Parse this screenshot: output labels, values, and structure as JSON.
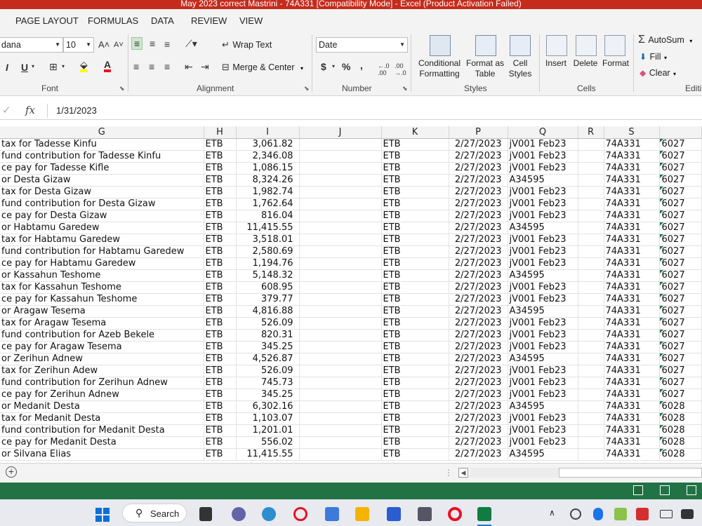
{
  "window_title": "May 2023 correct Mastrini - 74A331  [Compatibility Mode] -  Excel (Product Activation Failed)",
  "menu": [
    "PAGE LAYOUT",
    "FORMULAS",
    "DATA",
    "REVIEW",
    "VIEW"
  ],
  "ribbon": {
    "font_name": "dana",
    "font_size": "10",
    "wrap_text": "Wrap Text",
    "merge_center": "Merge & Center",
    "number_format": "Date",
    "currency_symbol": "$",
    "percent_symbol": "%",
    "comma_symbol": ",",
    "conditional_formatting": "Conditional Formatting",
    "format_as_table": "Format as Table",
    "cell_styles": "Cell Styles",
    "insert": "Insert",
    "delete": "Delete",
    "format": "Format",
    "autosum": "AutoSum",
    "fill": "Fill",
    "clear": "Clear",
    "groups": {
      "font": "Font",
      "alignment": "Alignment",
      "number": "Number",
      "styles": "Styles",
      "cells": "Cells",
      "editing": "Editi"
    }
  },
  "formula_bar": {
    "fx": "fx",
    "value": "1/31/2023"
  },
  "columns": [
    "G",
    "H",
    "I",
    "J",
    "K",
    "P",
    "Q",
    "R",
    "S",
    ""
  ],
  "rows": [
    [
      "tax for Tadesse Kinfu",
      "ETB",
      "3,061.82",
      "",
      "ETB",
      "2/27/2023",
      "jV001 Feb23",
      "",
      "74A331",
      "6027"
    ],
    [
      " fund contribution for Tadesse Kinfu",
      "ETB",
      "2,346.08",
      "",
      "ETB",
      "2/27/2023",
      "jV001 Feb23",
      "",
      "74A331",
      "6027"
    ],
    [
      "ce pay for Tadesse Kifle",
      "ETB",
      "1,086.15",
      "",
      "ETB",
      "2/27/2023",
      "jV001 Feb23",
      "",
      "74A331",
      "6027"
    ],
    [
      "or Desta Gizaw",
      "ETB",
      "8,324.26",
      "",
      "ETB",
      "2/27/2023",
      "A34595",
      "",
      "74A331",
      "6027"
    ],
    [
      "tax for Desta Gizaw",
      "ETB",
      "1,982.74",
      "",
      "ETB",
      "2/27/2023",
      "jV001 Feb23",
      "",
      "74A331",
      "6027"
    ],
    [
      " fund contribution for Desta Gizaw",
      "ETB",
      "1,762.64",
      "",
      "ETB",
      "2/27/2023",
      "jV001 Feb23",
      "",
      "74A331",
      "6027"
    ],
    [
      "ce pay for Desta Gizaw",
      "ETB",
      "816.04",
      "",
      "ETB",
      "2/27/2023",
      "jV001 Feb23",
      "",
      "74A331",
      "6027"
    ],
    [
      "or Habtamu Garedew",
      "ETB",
      "11,415.55",
      "",
      "ETB",
      "2/27/2023",
      "A34595",
      "",
      "74A331",
      "6027"
    ],
    [
      "tax for Habtamu Garedew",
      "ETB",
      "3,518.01",
      "",
      "ETB",
      "2/27/2023",
      "jV001 Feb23",
      "",
      "74A331",
      "6027"
    ],
    [
      " fund contribution for Habtamu Garedew",
      "ETB",
      "2,580.69",
      "",
      "ETB",
      "2/27/2023",
      "jV001 Feb23",
      "",
      "74A331",
      "6027"
    ],
    [
      "ce pay for Habtamu Garedew",
      "ETB",
      "1,194.76",
      "",
      "ETB",
      "2/27/2023",
      "jV001 Feb23",
      "",
      "74A331",
      "6027"
    ],
    [
      "or Kassahun Teshome",
      "ETB",
      "5,148.32",
      "",
      "ETB",
      "2/27/2023",
      "A34595",
      "",
      "74A331",
      "6027"
    ],
    [
      "tax for Kassahun Teshome",
      "ETB",
      "608.95",
      "",
      "ETB",
      "2/27/2023",
      "jV001 Feb23",
      "",
      "74A331",
      "6027"
    ],
    [
      "ce pay for Kassahun Teshome",
      "ETB",
      "379.77",
      "",
      "ETB",
      "2/27/2023",
      "jV001 Feb23",
      "",
      "74A331",
      "6027"
    ],
    [
      "or Aragaw Tesema",
      "ETB",
      "4,816.88",
      "",
      "ETB",
      "2/27/2023",
      "A34595",
      "",
      "74A331",
      "6027"
    ],
    [
      "tax for Aragaw Tesema",
      "ETB",
      "526.09",
      "",
      "ETB",
      "2/27/2023",
      "jV001 Feb23",
      "",
      "74A331",
      "6027"
    ],
    [
      " fund contribution for Azeb Bekele",
      "ETB",
      "820.31",
      "",
      "ETB",
      "2/27/2023",
      "jV001 Feb23",
      "",
      "74A331",
      "6027"
    ],
    [
      "ce pay for Aragaw Tesema",
      "ETB",
      "345.25",
      "",
      "ETB",
      "2/27/2023",
      "jV001 Feb23",
      "",
      "74A331",
      "6027"
    ],
    [
      "or Zerihun Adnew",
      "ETB",
      "4,526.87",
      "",
      "ETB",
      "2/27/2023",
      "A34595",
      "",
      "74A331",
      "6027"
    ],
    [
      "tax for Zerihun Adew",
      "ETB",
      "526.09",
      "",
      "ETB",
      "2/27/2023",
      "jV001 Feb23",
      "",
      "74A331",
      "6027"
    ],
    [
      " fund contribution for Zerihun Adnew",
      "ETB",
      "745.73",
      "",
      "ETB",
      "2/27/2023",
      "jV001 Feb23",
      "",
      "74A331",
      "6027"
    ],
    [
      "ce pay for Zerihun Adnew",
      "ETB",
      "345.25",
      "",
      "ETB",
      "2/27/2023",
      "jV001 Feb23",
      "",
      "74A331",
      "6027"
    ],
    [
      "or Medanit Desta",
      "ETB",
      "6,302.16",
      "",
      "ETB",
      "2/27/2023",
      "A34595",
      "",
      "74A331",
      "6028"
    ],
    [
      "tax for Medanit Desta",
      "ETB",
      "1,103.07",
      "",
      "ETB",
      "2/27/2023",
      "jV001 Feb23",
      "",
      "74A331",
      "6028"
    ],
    [
      " fund contribution for Medanit Desta",
      "ETB",
      "1,201.01",
      "",
      "ETB",
      "2/27/2023",
      "jV001 Feb23",
      "",
      "74A331",
      "6028"
    ],
    [
      "ce pay for Medanit Desta",
      "ETB",
      "556.02",
      "",
      "ETB",
      "2/27/2023",
      "jV001 Feb23",
      "",
      "74A331",
      "6028"
    ],
    [
      "or Silvana Elias",
      "ETB",
      "11,415.55",
      "",
      "ETB",
      "2/27/2023",
      "A34595",
      "",
      "74A331",
      "6028"
    ]
  ],
  "taskbar": {
    "search": "Search"
  },
  "colors": {
    "title_bar": "#c42b1c",
    "status_bar": "#217346",
    "text_flag": "#1e7145"
  }
}
